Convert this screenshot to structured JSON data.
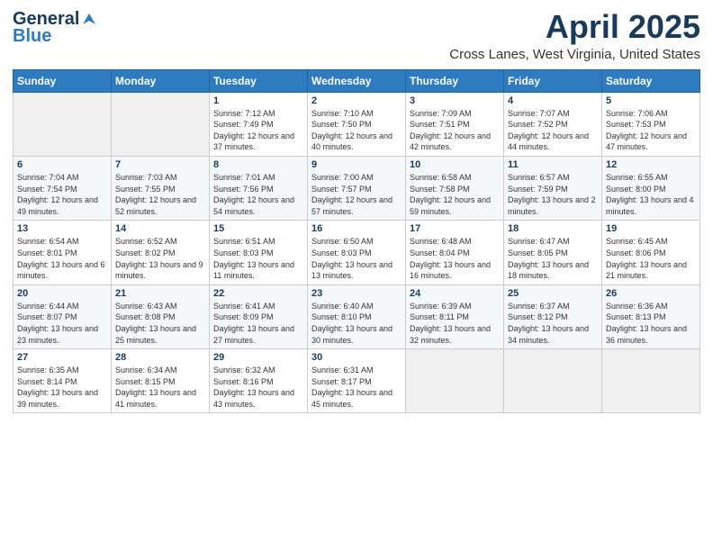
{
  "header": {
    "logo_line1": "General",
    "logo_line2": "Blue",
    "month": "April 2025",
    "location": "Cross Lanes, West Virginia, United States"
  },
  "weekdays": [
    "Sunday",
    "Monday",
    "Tuesday",
    "Wednesday",
    "Thursday",
    "Friday",
    "Saturday"
  ],
  "weeks": [
    [
      {
        "day": "",
        "sunrise": "",
        "sunset": "",
        "daylight": ""
      },
      {
        "day": "",
        "sunrise": "",
        "sunset": "",
        "daylight": ""
      },
      {
        "day": "1",
        "sunrise": "Sunrise: 7:12 AM",
        "sunset": "Sunset: 7:49 PM",
        "daylight": "Daylight: 12 hours and 37 minutes."
      },
      {
        "day": "2",
        "sunrise": "Sunrise: 7:10 AM",
        "sunset": "Sunset: 7:50 PM",
        "daylight": "Daylight: 12 hours and 40 minutes."
      },
      {
        "day": "3",
        "sunrise": "Sunrise: 7:09 AM",
        "sunset": "Sunset: 7:51 PM",
        "daylight": "Daylight: 12 hours and 42 minutes."
      },
      {
        "day": "4",
        "sunrise": "Sunrise: 7:07 AM",
        "sunset": "Sunset: 7:52 PM",
        "daylight": "Daylight: 12 hours and 44 minutes."
      },
      {
        "day": "5",
        "sunrise": "Sunrise: 7:06 AM",
        "sunset": "Sunset: 7:53 PM",
        "daylight": "Daylight: 12 hours and 47 minutes."
      }
    ],
    [
      {
        "day": "6",
        "sunrise": "Sunrise: 7:04 AM",
        "sunset": "Sunset: 7:54 PM",
        "daylight": "Daylight: 12 hours and 49 minutes."
      },
      {
        "day": "7",
        "sunrise": "Sunrise: 7:03 AM",
        "sunset": "Sunset: 7:55 PM",
        "daylight": "Daylight: 12 hours and 52 minutes."
      },
      {
        "day": "8",
        "sunrise": "Sunrise: 7:01 AM",
        "sunset": "Sunset: 7:56 PM",
        "daylight": "Daylight: 12 hours and 54 minutes."
      },
      {
        "day": "9",
        "sunrise": "Sunrise: 7:00 AM",
        "sunset": "Sunset: 7:57 PM",
        "daylight": "Daylight: 12 hours and 57 minutes."
      },
      {
        "day": "10",
        "sunrise": "Sunrise: 6:58 AM",
        "sunset": "Sunset: 7:58 PM",
        "daylight": "Daylight: 12 hours and 59 minutes."
      },
      {
        "day": "11",
        "sunrise": "Sunrise: 6:57 AM",
        "sunset": "Sunset: 7:59 PM",
        "daylight": "Daylight: 13 hours and 2 minutes."
      },
      {
        "day": "12",
        "sunrise": "Sunrise: 6:55 AM",
        "sunset": "Sunset: 8:00 PM",
        "daylight": "Daylight: 13 hours and 4 minutes."
      }
    ],
    [
      {
        "day": "13",
        "sunrise": "Sunrise: 6:54 AM",
        "sunset": "Sunset: 8:01 PM",
        "daylight": "Daylight: 13 hours and 6 minutes."
      },
      {
        "day": "14",
        "sunrise": "Sunrise: 6:52 AM",
        "sunset": "Sunset: 8:02 PM",
        "daylight": "Daylight: 13 hours and 9 minutes."
      },
      {
        "day": "15",
        "sunrise": "Sunrise: 6:51 AM",
        "sunset": "Sunset: 8:03 PM",
        "daylight": "Daylight: 13 hours and 11 minutes."
      },
      {
        "day": "16",
        "sunrise": "Sunrise: 6:50 AM",
        "sunset": "Sunset: 8:03 PM",
        "daylight": "Daylight: 13 hours and 13 minutes."
      },
      {
        "day": "17",
        "sunrise": "Sunrise: 6:48 AM",
        "sunset": "Sunset: 8:04 PM",
        "daylight": "Daylight: 13 hours and 16 minutes."
      },
      {
        "day": "18",
        "sunrise": "Sunrise: 6:47 AM",
        "sunset": "Sunset: 8:05 PM",
        "daylight": "Daylight: 13 hours and 18 minutes."
      },
      {
        "day": "19",
        "sunrise": "Sunrise: 6:45 AM",
        "sunset": "Sunset: 8:06 PM",
        "daylight": "Daylight: 13 hours and 21 minutes."
      }
    ],
    [
      {
        "day": "20",
        "sunrise": "Sunrise: 6:44 AM",
        "sunset": "Sunset: 8:07 PM",
        "daylight": "Daylight: 13 hours and 23 minutes."
      },
      {
        "day": "21",
        "sunrise": "Sunrise: 6:43 AM",
        "sunset": "Sunset: 8:08 PM",
        "daylight": "Daylight: 13 hours and 25 minutes."
      },
      {
        "day": "22",
        "sunrise": "Sunrise: 6:41 AM",
        "sunset": "Sunset: 8:09 PM",
        "daylight": "Daylight: 13 hours and 27 minutes."
      },
      {
        "day": "23",
        "sunrise": "Sunrise: 6:40 AM",
        "sunset": "Sunset: 8:10 PM",
        "daylight": "Daylight: 13 hours and 30 minutes."
      },
      {
        "day": "24",
        "sunrise": "Sunrise: 6:39 AM",
        "sunset": "Sunset: 8:11 PM",
        "daylight": "Daylight: 13 hours and 32 minutes."
      },
      {
        "day": "25",
        "sunrise": "Sunrise: 6:37 AM",
        "sunset": "Sunset: 8:12 PM",
        "daylight": "Daylight: 13 hours and 34 minutes."
      },
      {
        "day": "26",
        "sunrise": "Sunrise: 6:36 AM",
        "sunset": "Sunset: 8:13 PM",
        "daylight": "Daylight: 13 hours and 36 minutes."
      }
    ],
    [
      {
        "day": "27",
        "sunrise": "Sunrise: 6:35 AM",
        "sunset": "Sunset: 8:14 PM",
        "daylight": "Daylight: 13 hours and 39 minutes."
      },
      {
        "day": "28",
        "sunrise": "Sunrise: 6:34 AM",
        "sunset": "Sunset: 8:15 PM",
        "daylight": "Daylight: 13 hours and 41 minutes."
      },
      {
        "day": "29",
        "sunrise": "Sunrise: 6:32 AM",
        "sunset": "Sunset: 8:16 PM",
        "daylight": "Daylight: 13 hours and 43 minutes."
      },
      {
        "day": "30",
        "sunrise": "Sunrise: 6:31 AM",
        "sunset": "Sunset: 8:17 PM",
        "daylight": "Daylight: 13 hours and 45 minutes."
      },
      {
        "day": "",
        "sunrise": "",
        "sunset": "",
        "daylight": ""
      },
      {
        "day": "",
        "sunrise": "",
        "sunset": "",
        "daylight": ""
      },
      {
        "day": "",
        "sunrise": "",
        "sunset": "",
        "daylight": ""
      }
    ]
  ]
}
